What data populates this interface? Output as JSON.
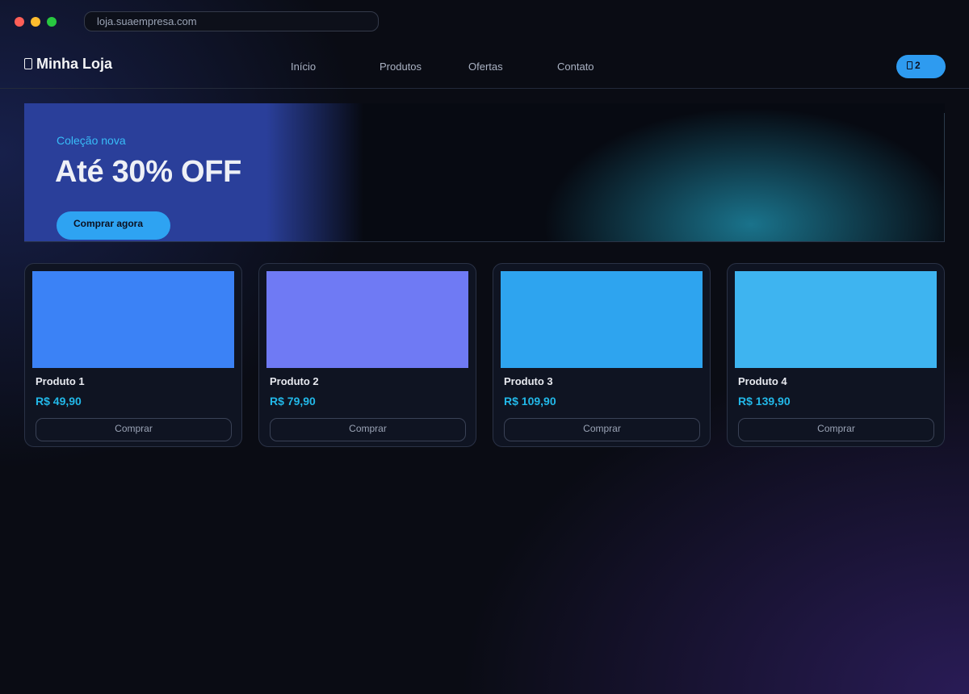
{
  "browser": {
    "url": "loja.suaempresa.com"
  },
  "nav": {
    "brand": "Minha Loja",
    "brand_icon": "bag-icon",
    "links": [
      "Início",
      "Produtos",
      "Ofertas",
      "Contato"
    ],
    "cart_icon": "bag-icon",
    "cart_count": "2"
  },
  "hero": {
    "eyebrow": "Coleção nova",
    "title": "Até 30% OFF",
    "button": "Comprar agora"
  },
  "products": [
    {
      "name": "Produto 1",
      "price": "R$ 49,90",
      "button": "Comprar",
      "image_color": "#3b82f6"
    },
    {
      "name": "Produto 2",
      "price": "R$ 79,90",
      "button": "Comprar",
      "image_color": "#6f7af4"
    },
    {
      "name": "Produto 3",
      "price": "R$ 109,90",
      "button": "Comprar",
      "image_color": "#2ea4ef"
    },
    {
      "name": "Produto 4",
      "price": "R$ 139,90",
      "button": "Comprar",
      "image_color": "#3eb4f0"
    }
  ],
  "colors": {
    "accent": "#2e9bf0",
    "price": "#22b8e8",
    "eyebrow": "#38bdf8",
    "background": "#0a0c14"
  }
}
